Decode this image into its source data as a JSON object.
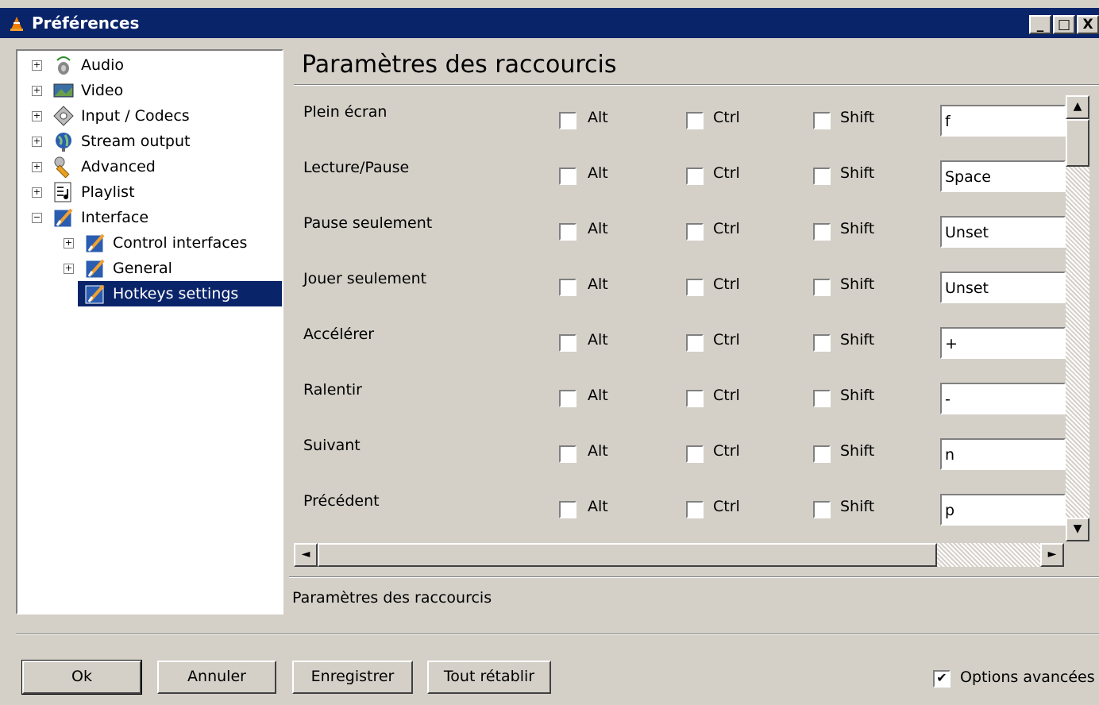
{
  "window": {
    "title": "Préférences",
    "controls": [
      "_",
      "□",
      "X"
    ]
  },
  "tree": {
    "items": [
      {
        "label": "Audio",
        "icon": "speaker-icon",
        "expander": "+",
        "level": 0
      },
      {
        "label": "Video",
        "icon": "video-icon",
        "expander": "+",
        "level": 0
      },
      {
        "label": "Input / Codecs",
        "icon": "disc-icon",
        "expander": "+",
        "level": 0
      },
      {
        "label": "Stream output",
        "icon": "globe-icon",
        "expander": "+",
        "level": 0
      },
      {
        "label": "Advanced",
        "icon": "wrench-icon",
        "expander": "+",
        "level": 0
      },
      {
        "label": "Playlist",
        "icon": "playlist-icon",
        "expander": "+",
        "level": 0
      },
      {
        "label": "Interface",
        "icon": "interface-icon",
        "expander": "−",
        "level": 0
      },
      {
        "label": "Control interfaces",
        "icon": "interface-icon",
        "expander": "+",
        "level": 1
      },
      {
        "label": "General",
        "icon": "interface-icon",
        "expander": "+",
        "level": 1
      },
      {
        "label": "Hotkeys settings",
        "icon": "interface-icon",
        "expander": "",
        "level": 1,
        "selected": true
      }
    ]
  },
  "panel": {
    "title": "Paramètres des raccourcis",
    "modifiers": {
      "alt": "Alt",
      "ctrl": "Ctrl",
      "shift": "Shift"
    },
    "rows": [
      {
        "label": "Plein écran",
        "key": "f"
      },
      {
        "label": "Lecture/Pause",
        "key": "Space"
      },
      {
        "label": "Pause seulement",
        "key": "Unset"
      },
      {
        "label": "Jouer seulement",
        "key": "Unset"
      },
      {
        "label": "Accélérer",
        "key": "+"
      },
      {
        "label": "Ralentir",
        "key": "-"
      },
      {
        "label": "Suivant",
        "key": "n"
      },
      {
        "label": "Précédent",
        "key": "p"
      }
    ],
    "description": "Paramètres des raccourcis"
  },
  "buttons": {
    "ok": "Ok",
    "cancel": "Annuler",
    "save": "Enregistrer",
    "reset": "Tout rétablir"
  },
  "advanced_options": {
    "label": "Options avancées",
    "checked": true
  },
  "colors": {
    "titlebar": "#0a246a",
    "selection": "#0a246a",
    "face": "#d4d0c8"
  }
}
